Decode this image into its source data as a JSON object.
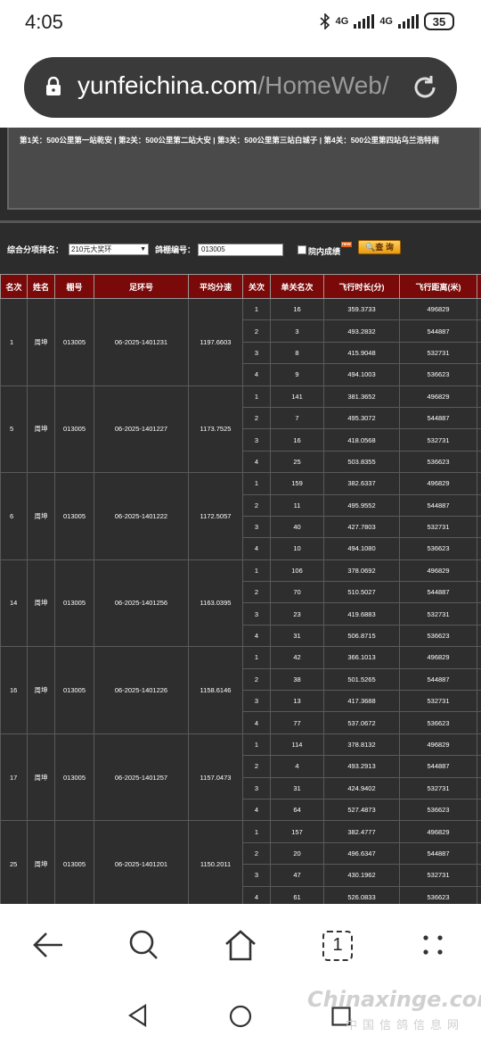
{
  "status": {
    "time": "4:05",
    "net1": "4G",
    "net2": "4G",
    "battery": "35"
  },
  "browser": {
    "url_main": "yunfeichina.com",
    "url_path": "/HomeWeb/",
    "tab_count": "1"
  },
  "notice": "第1关：500公里第一站乾安 | 第2关：500公里第二站大安 | 第3关：500公里第三站白城子 | 第4关：500公里第四站乌兰浩特南",
  "filter": {
    "rank_label": "综合分项排名：",
    "rank_value": "210元大奖环",
    "loft_label": "鸽棚编号：",
    "loft_value": "013005",
    "internal_label": "院内成绩",
    "new_badge": "new",
    "query_label": "查 询"
  },
  "table": {
    "headers": [
      "名次",
      "姓名",
      "棚号",
      "足环号",
      "平均分速",
      "关次",
      "单关名次",
      "飞行时长(分)",
      "飞行距离(米)"
    ],
    "groups": [
      {
        "rank": "1",
        "name": "周坤",
        "loft": "013005",
        "ring": "06-2025-1401231",
        "avg": "1197.6603",
        "stages": [
          [
            "1",
            "16",
            "359.3733",
            "496829"
          ],
          [
            "2",
            "3",
            "493.2832",
            "544887"
          ],
          [
            "3",
            "8",
            "415.9048",
            "532731"
          ],
          [
            "4",
            "9",
            "494.1003",
            "536623"
          ]
        ]
      },
      {
        "rank": "5",
        "name": "周坤",
        "loft": "013005",
        "ring": "06-2025-1401227",
        "avg": "1173.7525",
        "stages": [
          [
            "1",
            "141",
            "381.3652",
            "496829"
          ],
          [
            "2",
            "7",
            "495.3072",
            "544887"
          ],
          [
            "3",
            "16",
            "418.0568",
            "532731"
          ],
          [
            "4",
            "25",
            "503.8355",
            "536623"
          ]
        ]
      },
      {
        "rank": "6",
        "name": "周坤",
        "loft": "013005",
        "ring": "06-2025-1401222",
        "avg": "1172.5057",
        "stages": [
          [
            "1",
            "159",
            "382.6337",
            "496829"
          ],
          [
            "2",
            "11",
            "495.9552",
            "544887"
          ],
          [
            "3",
            "40",
            "427.7803",
            "532731"
          ],
          [
            "4",
            "10",
            "494.1080",
            "536623"
          ]
        ]
      },
      {
        "rank": "14",
        "name": "周坤",
        "loft": "013005",
        "ring": "06-2025-1401256",
        "avg": "1163.0395",
        "stages": [
          [
            "1",
            "106",
            "378.0692",
            "496829"
          ],
          [
            "2",
            "70",
            "510.5027",
            "544887"
          ],
          [
            "3",
            "23",
            "419.6883",
            "532731"
          ],
          [
            "4",
            "31",
            "506.8715",
            "536623"
          ]
        ]
      },
      {
        "rank": "16",
        "name": "周坤",
        "loft": "013005",
        "ring": "06-2025-1401226",
        "avg": "1158.6146",
        "stages": [
          [
            "1",
            "42",
            "366.1013",
            "496829"
          ],
          [
            "2",
            "38",
            "501.5265",
            "544887"
          ],
          [
            "3",
            "13",
            "417.3688",
            "532731"
          ],
          [
            "4",
            "77",
            "537.0672",
            "536623"
          ]
        ]
      },
      {
        "rank": "17",
        "name": "周坤",
        "loft": "013005",
        "ring": "06-2025-1401257",
        "avg": "1157.0473",
        "stages": [
          [
            "1",
            "114",
            "378.8132",
            "496829"
          ],
          [
            "2",
            "4",
            "493.2913",
            "544887"
          ],
          [
            "3",
            "31",
            "424.9402",
            "532731"
          ],
          [
            "4",
            "64",
            "527.4873",
            "536623"
          ]
        ]
      },
      {
        "rank": "25",
        "name": "周坤",
        "loft": "013005",
        "ring": "06-2025-1401201",
        "avg": "1150.2011",
        "stages": [
          [
            "1",
            "157",
            "382.4777",
            "496829"
          ],
          [
            "2",
            "20",
            "496.6347",
            "544887"
          ],
          [
            "3",
            "47",
            "430.1962",
            "532731"
          ],
          [
            "4",
            "61",
            "526.0833",
            "536623"
          ]
        ]
      }
    ]
  },
  "watermark": {
    "main": "Chinaxinge.com",
    "sub": "中国信鸽信息网"
  }
}
